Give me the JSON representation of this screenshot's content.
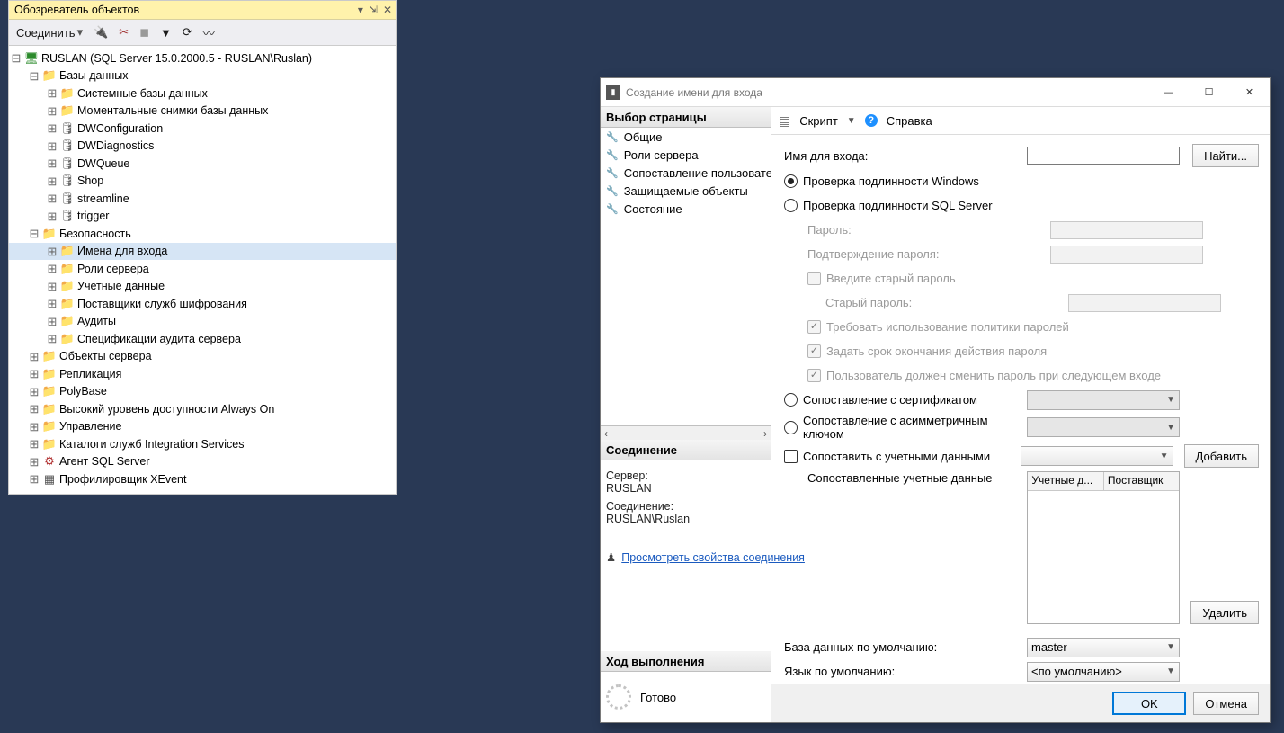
{
  "objectExplorer": {
    "title": "Обозреватель объектов",
    "toolbar": {
      "connect": "Соединить"
    },
    "tree": [
      {
        "depth": 0,
        "exp": "minus",
        "icon": "server",
        "label": "RUSLAN (SQL Server 15.0.2000.5 - RUSLAN\\Ruslan)"
      },
      {
        "depth": 1,
        "exp": "minus",
        "icon": "folder",
        "label": "Базы данных"
      },
      {
        "depth": 2,
        "exp": "plus",
        "icon": "folder",
        "label": "Системные базы данных"
      },
      {
        "depth": 2,
        "exp": "plus",
        "icon": "folder",
        "label": "Моментальные снимки базы данных"
      },
      {
        "depth": 2,
        "exp": "plus",
        "icon": "db",
        "label": "DWConfiguration"
      },
      {
        "depth": 2,
        "exp": "plus",
        "icon": "db",
        "label": "DWDiagnostics"
      },
      {
        "depth": 2,
        "exp": "plus",
        "icon": "db",
        "label": "DWQueue"
      },
      {
        "depth": 2,
        "exp": "plus",
        "icon": "db",
        "label": "Shop"
      },
      {
        "depth": 2,
        "exp": "plus",
        "icon": "db",
        "label": "streamline"
      },
      {
        "depth": 2,
        "exp": "plus",
        "icon": "db",
        "label": "trigger"
      },
      {
        "depth": 1,
        "exp": "minus",
        "icon": "folder",
        "label": "Безопасность"
      },
      {
        "depth": 2,
        "exp": "plus",
        "icon": "folder",
        "label": "Имена для входа",
        "selected": true
      },
      {
        "depth": 2,
        "exp": "plus",
        "icon": "folder",
        "label": "Роли сервера"
      },
      {
        "depth": 2,
        "exp": "plus",
        "icon": "folder",
        "label": "Учетные данные"
      },
      {
        "depth": 2,
        "exp": "plus",
        "icon": "folder",
        "label": "Поставщики служб шифрования"
      },
      {
        "depth": 2,
        "exp": "plus",
        "icon": "folder",
        "label": "Аудиты"
      },
      {
        "depth": 2,
        "exp": "plus",
        "icon": "folder",
        "label": "Спецификации аудита сервера"
      },
      {
        "depth": 1,
        "exp": "plus",
        "icon": "folder",
        "label": "Объекты сервера"
      },
      {
        "depth": 1,
        "exp": "plus",
        "icon": "folder",
        "label": "Репликация"
      },
      {
        "depth": 1,
        "exp": "plus",
        "icon": "folder",
        "label": "PolyBase"
      },
      {
        "depth": 1,
        "exp": "plus",
        "icon": "folder",
        "label": "Высокий уровень доступности Always On"
      },
      {
        "depth": 1,
        "exp": "plus",
        "icon": "folder",
        "label": "Управление"
      },
      {
        "depth": 1,
        "exp": "plus",
        "icon": "folder",
        "label": "Каталоги служб Integration Services"
      },
      {
        "depth": 1,
        "exp": "plus",
        "icon": "agent",
        "label": "Агент SQL Server"
      },
      {
        "depth": 1,
        "exp": "plus",
        "icon": "generic",
        "label": "Профилировщик XEvent"
      }
    ]
  },
  "dialog": {
    "title": "Создание имени для входа",
    "left": {
      "pageHeader": "Выбор страницы",
      "pages": [
        "Общие",
        "Роли сервера",
        "Сопоставление пользователей",
        "Защищаемые объекты",
        "Состояние"
      ],
      "connHeader": "Соединение",
      "serverLabel": "Сервер:",
      "serverValue": "RUSLAN",
      "connLabel": "Соединение:",
      "connValue": "RUSLAN\\Ruslan",
      "viewProps": "Просмотреть свойства соединения",
      "progressHeader": "Ход выполнения",
      "ready": "Готово"
    },
    "toolbar": {
      "script": "Скрипт",
      "help": "Справка"
    },
    "form": {
      "loginName": "Имя для входа:",
      "find": "Найти...",
      "winAuth": "Проверка подлинности Windows",
      "sqlAuth": "Проверка подлинности SQL Server",
      "password": "Пароль:",
      "confirmPassword": "Подтверждение пароля:",
      "enterOld": "Введите старый пароль",
      "oldPassword": "Старый пароль:",
      "enforcePolicy": "Требовать использование политики паролей",
      "enforceExpire": "Задать срок окончания действия пароля",
      "mustChange": "Пользователь должен сменить пароль при следующем входе",
      "mapCert": "Сопоставление с сертификатом",
      "mapAsym": "Сопоставление с асимметричным ключом",
      "mapCred": "Сопоставить с учетными данными",
      "add": "Добавить",
      "mappedCreds": "Сопоставленные учетные данные",
      "colCred": "Учетные д...",
      "colProvider": "Поставщик",
      "remove": "Удалить",
      "defaultDb": "База данных по умолчанию:",
      "defaultDbVal": "master",
      "defaultLang": "Язык по умолчанию:",
      "defaultLangVal": "<по умолчанию>"
    },
    "footer": {
      "ok": "OK",
      "cancel": "Отмена"
    }
  }
}
